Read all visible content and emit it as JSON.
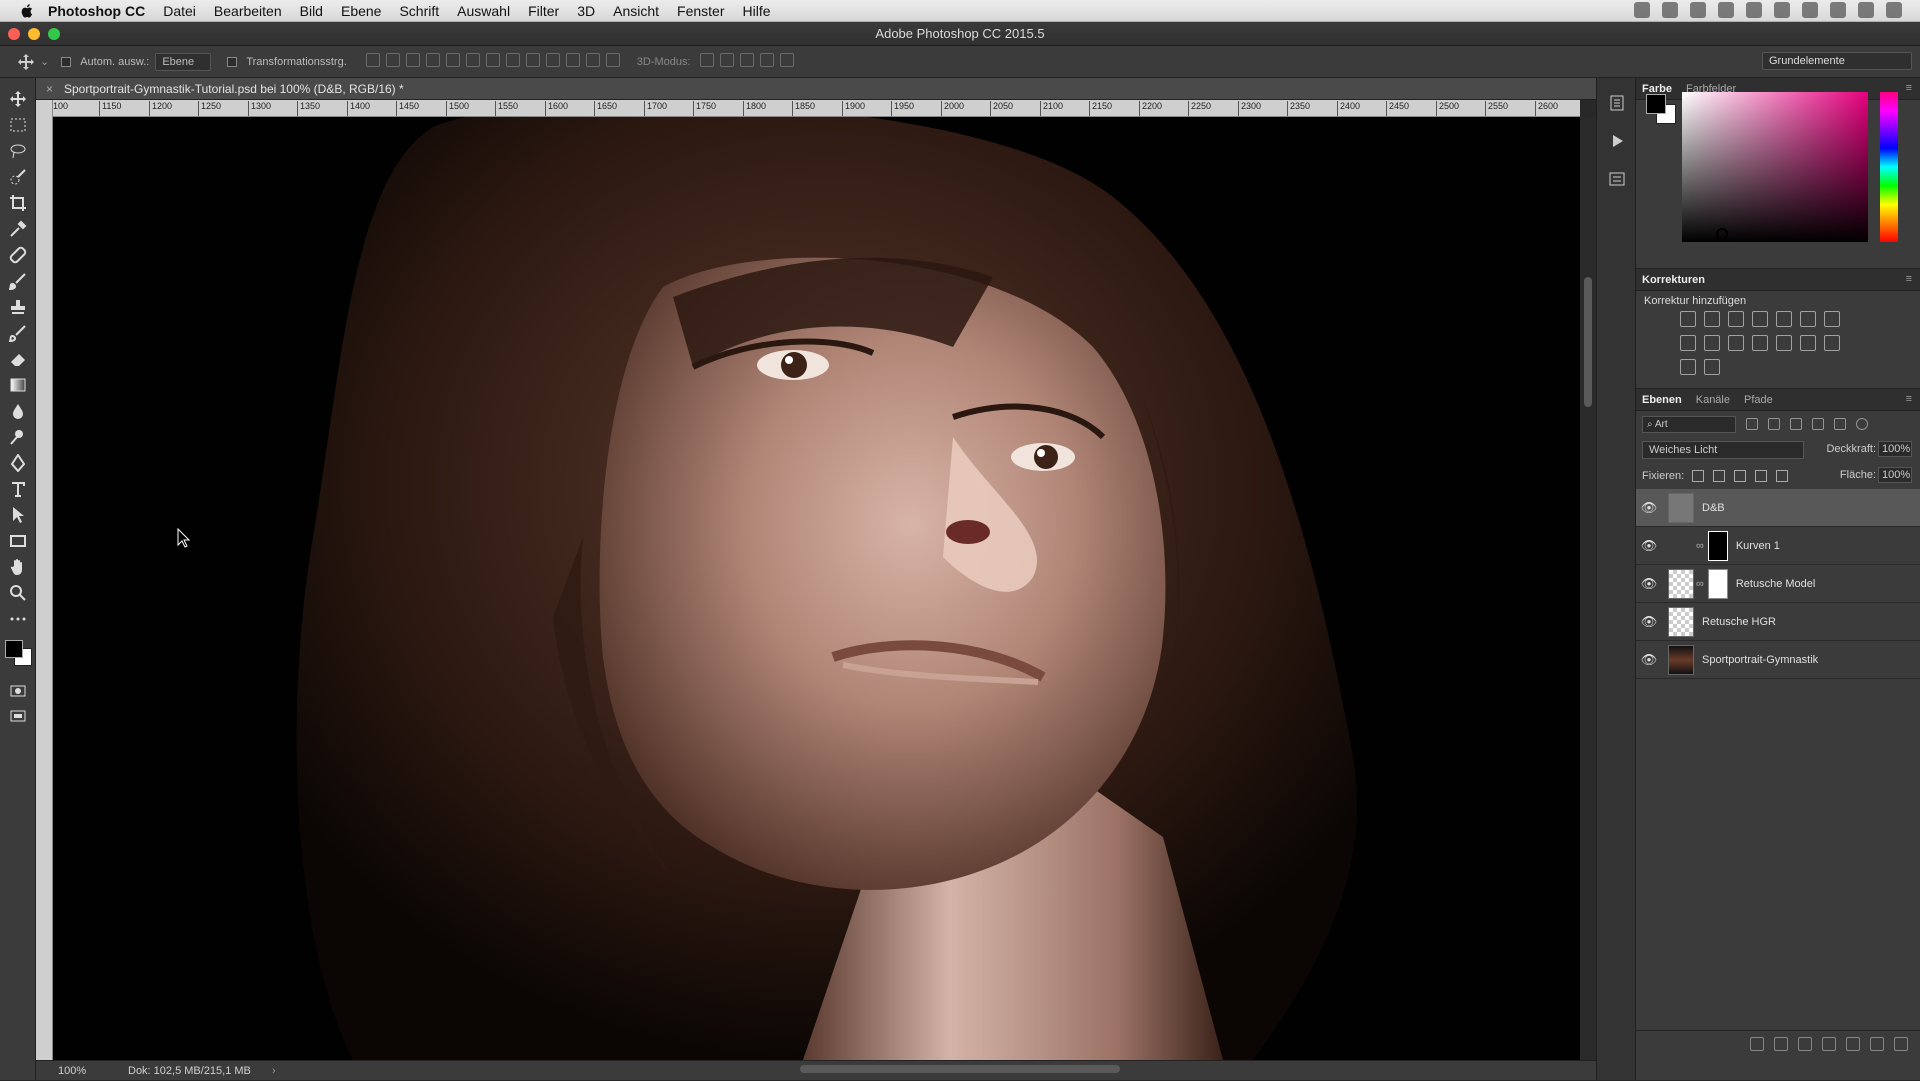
{
  "menubar": {
    "app_name": "Photoshop CC",
    "items": [
      "Datei",
      "Bearbeiten",
      "Bild",
      "Ebene",
      "Schrift",
      "Auswahl",
      "Filter",
      "3D",
      "Ansicht",
      "Fenster",
      "Hilfe"
    ]
  },
  "window": {
    "title": "Adobe Photoshop CC 2015.5"
  },
  "options": {
    "auto_select_label": "Autom. ausw.:",
    "auto_select_value": "Ebene",
    "transform_label": "Transformationsstrg.",
    "mode_3d_label": "3D-Modus:",
    "workspace": "Grundelemente"
  },
  "document": {
    "tab_title": "Sportportrait-Gymnastik-Tutorial.psd bei 100% (D&B, RGB/16) *",
    "zoom": "100%",
    "doc_info": "Dok: 102,5 MB/215,1 MB"
  },
  "ruler": {
    "h_ticks": [
      "100",
      "1150",
      "1200",
      "1250",
      "1300",
      "1350",
      "1400",
      "1450",
      "1500",
      "1550",
      "1600",
      "1650",
      "1700",
      "1750",
      "1800",
      "1850",
      "1900",
      "1950",
      "2000",
      "2050",
      "2100",
      "2150",
      "2200",
      "2250",
      "2300",
      "2350",
      "2400",
      "2450",
      "2500",
      "2550",
      "2600"
    ]
  },
  "color_panel": {
    "tabs": [
      "Farbe",
      "Farbfelder"
    ],
    "fg_color": "#000000",
    "bg_color": "#ffffff",
    "hue_color": "#e6007e"
  },
  "corrections_panel": {
    "title": "Korrekturen",
    "add_label": "Korrektur hinzufügen"
  },
  "layers_panel": {
    "tabs": [
      "Ebenen",
      "Kanäle",
      "Pfade"
    ],
    "filter_placeholder": "Art",
    "blend_mode": "Weiches Licht",
    "opacity_label": "Deckkraft:",
    "opacity_value": "100%",
    "lock_label": "Fixieren:",
    "fill_label": "Fläche:",
    "fill_value": "100%",
    "layers": [
      {
        "name": "D&B",
        "selected": true
      },
      {
        "name": "Kurven 1",
        "selected": false
      },
      {
        "name": "Retusche Model",
        "selected": false
      },
      {
        "name": "Retusche HGR",
        "selected": false
      },
      {
        "name": "Sportportrait-Gymnastik",
        "selected": false
      }
    ]
  }
}
